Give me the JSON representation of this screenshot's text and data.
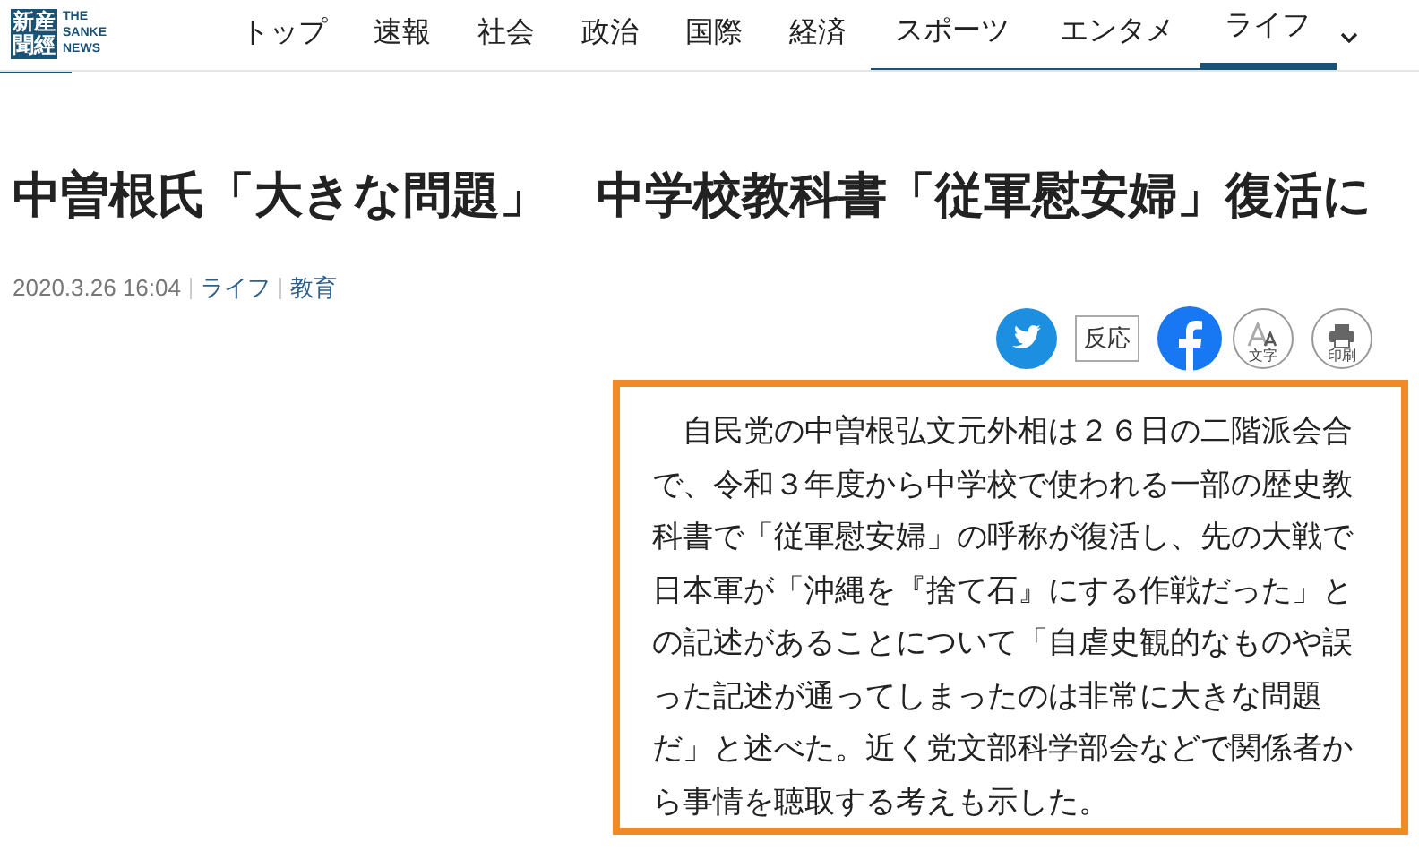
{
  "logo": {
    "kanji_columns": [
      "新聞",
      "産經"
    ],
    "wordmark": [
      "THE",
      "SANKE",
      "NEWS"
    ]
  },
  "nav": [
    {
      "label": "トップ",
      "selected": false
    },
    {
      "label": "速報",
      "selected": false
    },
    {
      "label": "社会",
      "selected": false
    },
    {
      "label": "政治",
      "selected": false
    },
    {
      "label": "国際",
      "selected": false
    },
    {
      "label": "経済",
      "selected": false
    },
    {
      "label": "スポーツ",
      "selected": false
    },
    {
      "label": "エンタメ",
      "selected": false
    },
    {
      "label": "ライフ",
      "selected": true
    }
  ],
  "headline": "中曽根氏「大きな問題」　中学校教科書「従軍慰安婦」復活に",
  "meta": {
    "date": "2020.3.26 16:04",
    "categories": [
      "ライフ",
      "教育"
    ]
  },
  "share": {
    "reaction": "反応",
    "font_size": "文字",
    "print": "印刷"
  },
  "body": "　自民党の中曽根弘文元外相は２６日の二階派会合で、令和３年度から中学校で使われる一部の歴史教科書で「従軍慰安婦」の呼称が復活し、先の大戦で日本軍が「沖縄を『捨て石』にする作戦だった」との記述があることについて「自虐史観的なものや誤った記述が通ってしまったのは非常に大きな問題だ」と述べた。近く党文部科学部会などで関係者から事情を聴取する考えも示した。"
}
